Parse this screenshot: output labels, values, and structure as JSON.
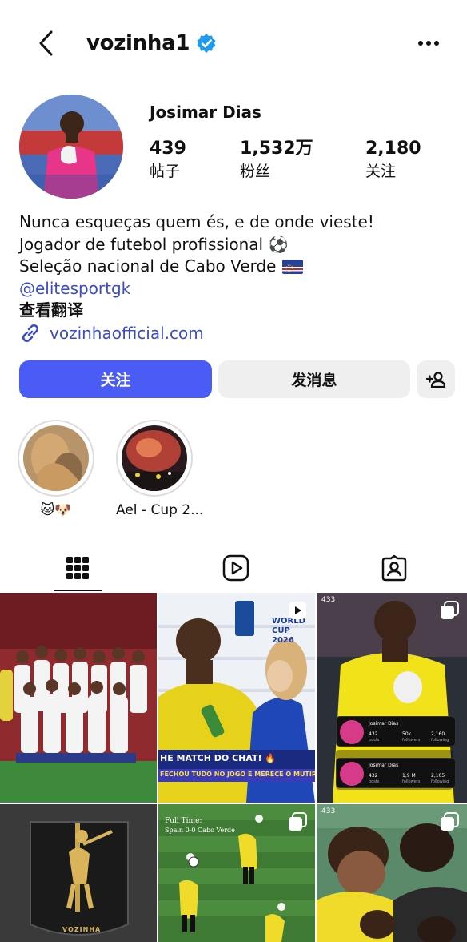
{
  "header": {
    "username": "vozinha1",
    "verified": true,
    "icons": {
      "back": "chevron-left-icon",
      "more": "more-horizontal-icon",
      "verified": "verified-badge-icon"
    }
  },
  "profile": {
    "display_name": "Josimar Dias",
    "stats": [
      {
        "value": "439",
        "label": "帖子"
      },
      {
        "value": "1,532万",
        "label": "粉丝"
      },
      {
        "value": "2,180",
        "label": "关注"
      }
    ]
  },
  "bio": {
    "lines": [
      "Nunca esqueças quem és, e de onde vieste!",
      "Jogador de futebol profissional ⚽",
      "Seleção nacional de Cabo Verde"
    ],
    "handle": "@elitesportgk",
    "translate": "查看翻译",
    "link": "vozinhaofficial.com"
  },
  "actions": {
    "follow": "关注",
    "message": "发消息"
  },
  "highlights": [
    {
      "label": "🐱🐶"
    },
    {
      "label": "Ael - Cup 2..."
    }
  ],
  "tabs": [
    {
      "icon": "grid-icon",
      "active": true
    },
    {
      "icon": "reels-icon",
      "active": false
    },
    {
      "icon": "tagged-icon",
      "active": false
    }
  ],
  "posts": {
    "p2_banner": "HE MATCH DO CHAT! 🔥",
    "p2_sub": "FECHOU TUDO NO JOGO E MERECE O MUTIRÃO",
    "p2_badge": "WORLD CUP 2026",
    "p3_corner": "433",
    "p3_card": [
      {
        "name": "Josimar Dias",
        "posts": "432",
        "followers": "50k",
        "following": "2,160"
      },
      {
        "name": "Josimar Dias",
        "posts": "432",
        "followers": "1,9 M",
        "following": "2,105"
      }
    ],
    "p3_labels": [
      "posts",
      "followers",
      "following"
    ],
    "p5_title": "Full Time:",
    "p5_sub": "Spain 0-0 Cabo Verde",
    "p4_plaque": "VOZINHA",
    "p6_corner": "433"
  },
  "colors": {
    "accent": "#4a5cf5",
    "link": "#3a4bc8",
    "verified": "#1d9bf0",
    "button_secondary": "#efefef"
  }
}
